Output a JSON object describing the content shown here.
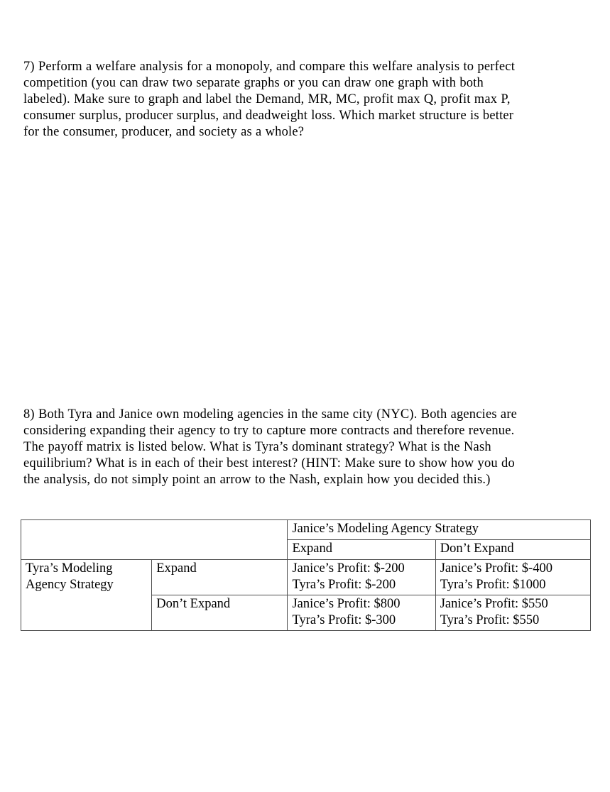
{
  "document": {
    "questions": [
      {
        "id": "7",
        "text": "7)  Perform a welfare analysis for a monopoly, and compare this welfare analysis to perfect competition (you can draw two separate graphs or you can draw one graph with both labeled).  Make sure to graph and label the Demand, MR, MC, profit max Q, profit max P, consumer surplus, producer surplus, and deadweight loss.  Which market structure is better for the consumer, producer, and society as a whole?"
      },
      {
        "id": "8",
        "text": "8) Both Tyra and Janice own modeling agencies in the same city (NYC).  Both agencies are considering expanding their agency to try to capture more contracts and therefore revenue.  The payoff matrix is listed below.  What is Tyra’s dominant strategy?  What is the Nash equilibrium?  What is in each of their best interest?  (HINT:  Make sure to show how you do the analysis, do not simply point an arrow to the Nash, explain how you decided this.)"
      }
    ],
    "payoff_matrix": {
      "corner": "",
      "column_group_header": "Janice’s Modeling Agency Strategy",
      "column_headers": [
        "Expand",
        "Don’t Expand"
      ],
      "row_group_header": "Tyra’s Modeling Agency Strategy",
      "row_headers": [
        "Expand",
        "Don’t Expand"
      ],
      "cells": {
        "expand_expand": {
          "line1": "Janice’s Profit: $-200",
          "line2": "Tyra’s Profit:  $-200"
        },
        "expand_dontexpand": {
          "line1": "Janice’s Profit:  $-400",
          "line2": "Tyra’s Profit:  $1000"
        },
        "dontexpand_expand": {
          "line1": "Janice’s Profit:  $800",
          "line2": "Tyra’s Profit:  $-300"
        },
        "dontexpand_dontexpand": {
          "line1": "Janice’s Profit:  $550",
          "line2": "Tyra’s Profit:  $550"
        }
      }
    },
    "colors": {
      "page_background": "#ffffff",
      "text": "#000000",
      "table_border": "#4d4d4d"
    }
  }
}
